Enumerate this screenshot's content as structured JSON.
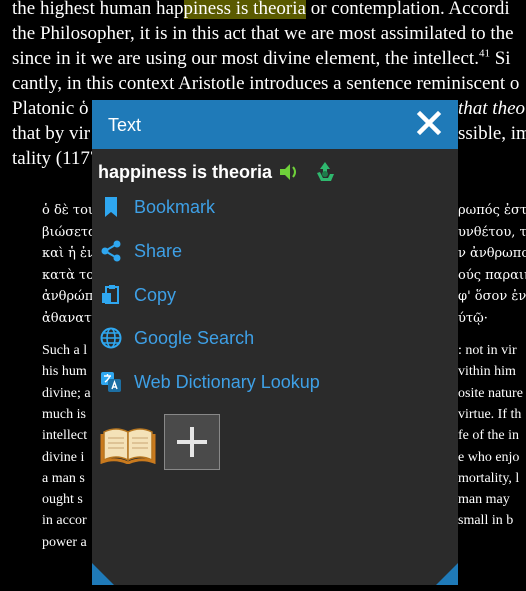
{
  "book": {
    "line1_a": "the highest human hap",
    "line1_hl": "piness is theoria",
    "line1_b": " or contemplation. Accordi",
    "line2": "the Philosopher, it is in this act that we are most assimilated to the",
    "line3_a": "since in it we are using our most divine element, the intellect.",
    "line3_sup": "41",
    "line3_b": " Si",
    "line4": "cantly, in this context Aristotle introduces a sentence reminiscent o",
    "line5_a": "Platonic ὁ",
    "line5_b": "that theo",
    "line6_a": "that by vir",
    "line6_b": "ssible, im",
    "line7": "tality (1177",
    "quote_left": [
      "ὁ δὲ τοι",
      "βιώσετα",
      "καὶ ἡ ἐνε",
      "κατὰ το",
      "ἀνθρώπι",
      "ἀθανατί"
    ],
    "quote_right": [
      "ρωπός ἐστι",
      "υνθέτου, το",
      "ν ἀνθρωπο",
      "ούς παραιν",
      "φ' ὅσον ἐνδ",
      "ύτῷ·"
    ],
    "body_left": [
      "Such a l",
      "his hum",
      "divine; a",
      "much is",
      "intellect",
      "divine i",
      "a man s",
      "ought s",
      "in accor",
      "power a"
    ],
    "body_right": [
      ": not in vir",
      "vithin him",
      "osite nature",
      "virtue. If th",
      "fe of the in",
      "e who enjo",
      "mortality, l",
      "man may",
      "small in b"
    ]
  },
  "popup": {
    "title": "Text",
    "selected_text": "happiness is theoria",
    "menu": [
      {
        "label": "Bookmark",
        "icon": "bookmark-icon"
      },
      {
        "label": "Share",
        "icon": "share-icon"
      },
      {
        "label": "Copy",
        "icon": "copy-icon"
      },
      {
        "label": "Google Search",
        "icon": "globe-icon"
      },
      {
        "label": "Web Dictionary Lookup",
        "icon": "translate-icon"
      }
    ],
    "colors": {
      "header": "#1f7ab8",
      "link": "#3ea0e6",
      "background": "#2b2b2b",
      "highlight": "#5a5a00"
    }
  }
}
